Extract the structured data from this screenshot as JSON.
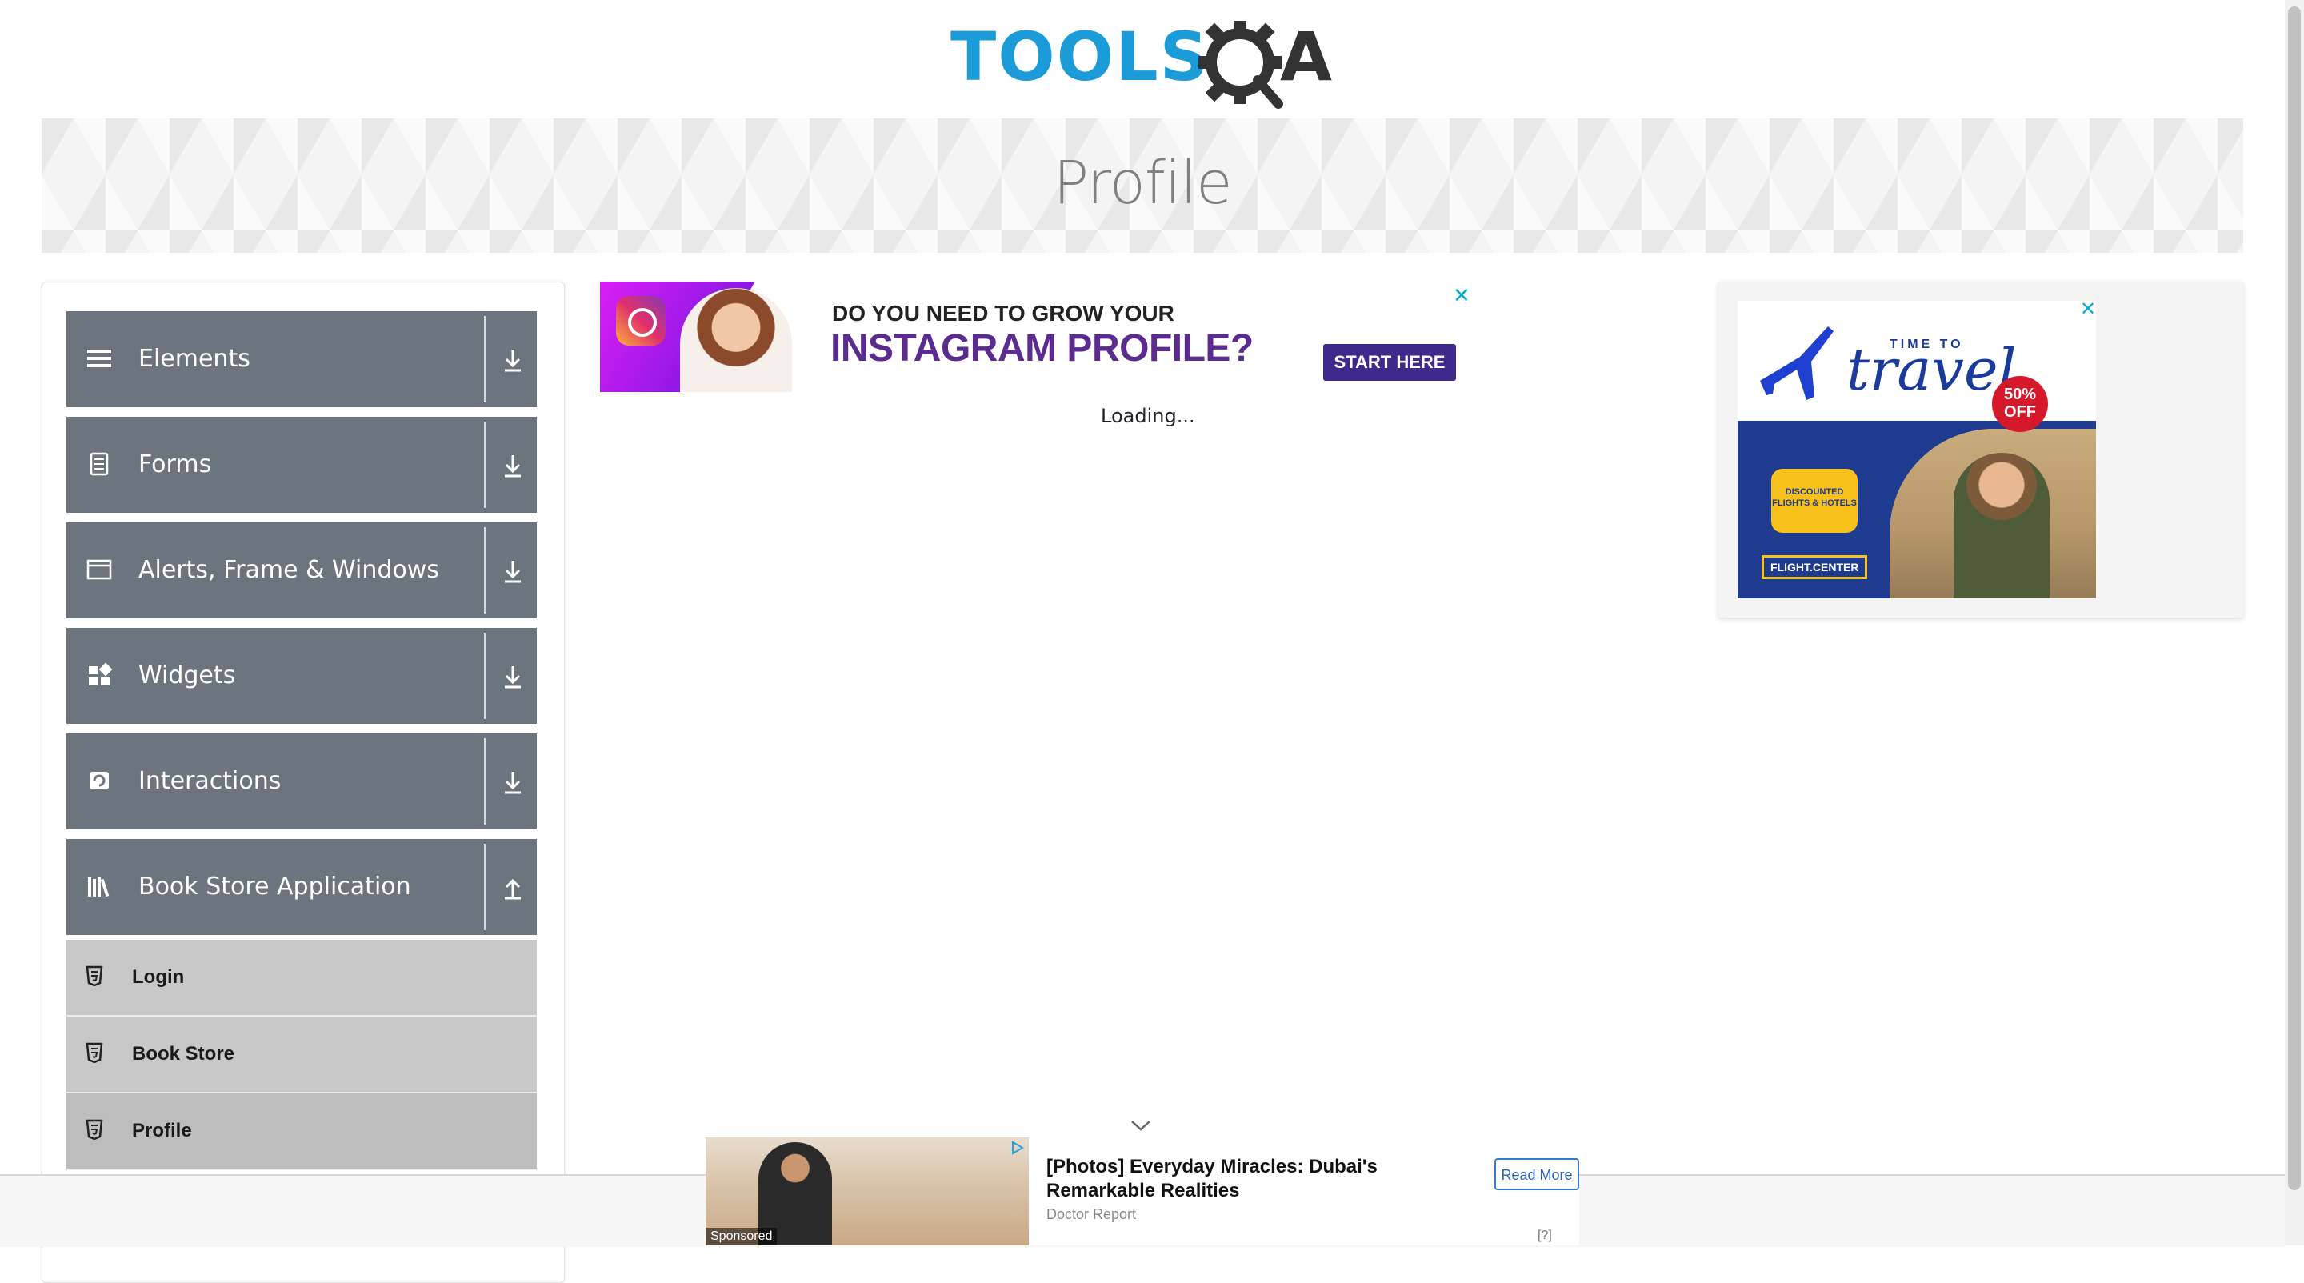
{
  "logo": {
    "text_left": "TOOLS",
    "text_right": "A",
    "colors": {
      "blue": "#1b9bd7",
      "dark": "#333333"
    }
  },
  "banner": {
    "title": "Profile"
  },
  "sidebar": {
    "groups": [
      {
        "label": "Elements",
        "icon": "list-icon",
        "state": "collapsed"
      },
      {
        "label": "Forms",
        "icon": "form-icon",
        "state": "collapsed"
      },
      {
        "label": "Alerts, Frame & Windows",
        "icon": "window-icon",
        "state": "collapsed"
      },
      {
        "label": "Widgets",
        "icon": "widgets-icon",
        "state": "collapsed"
      },
      {
        "label": "Interactions",
        "icon": "interactions-icon",
        "state": "collapsed"
      },
      {
        "label": "Book Store Application",
        "icon": "books-icon",
        "state": "expanded"
      }
    ],
    "subitems": [
      {
        "label": "Login",
        "icon": "html5-icon"
      },
      {
        "label": "Book Store",
        "icon": "html5-icon"
      },
      {
        "label": "Profile",
        "icon": "html5-icon"
      }
    ],
    "colors": {
      "group_bg": "#6c757d",
      "subitem_bg": "#c8c8c8"
    }
  },
  "ad_main": {
    "line1": "DO YOU NEED TO GROW YOUR",
    "line2": "INSTAGRAM PROFILE?",
    "cta": "START HERE",
    "close": "✕"
  },
  "main": {
    "loading": "Loading..."
  },
  "ad_right": {
    "small": "TIME TO",
    "big": "travel",
    "badge": "50% OFF",
    "bubble": "DISCOUNTED FLIGHTS & HOTELS",
    "brand": "FLIGHT.CENTER",
    "close": "✕"
  },
  "bottom_ad": {
    "title": "[Photos] Everyday Miracles: Dubai's Remarkable Realities",
    "source": "Doctor Report",
    "button": "Read More",
    "sponsored": "Sponsored",
    "help": "[?]"
  }
}
